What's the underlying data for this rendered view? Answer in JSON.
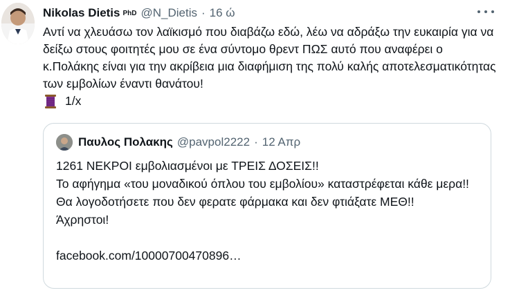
{
  "tweet": {
    "author_name": "Nikolas Dietis",
    "author_suffix": "PhD",
    "handle": "@N_Dietis",
    "separator": "·",
    "time": "16 ώ",
    "text": "Αντί να χλευάσω τον λαϊκισμό που διαβάζω εδώ, λέω να αδράξω την ευκαιρία για να δείξω στους φοιτητές μου σε ένα σύντομο θρεντ ΠΩΣ αυτό που αναφέρει ο κ.Πολάκης είναι για την ακρίβεια μια διαφήμιση της πολύ καλής αποτελεσματικότητας των εμβολίων έναντι θανάτου!",
    "thread_icon": "thread-spool-icon",
    "thread_marker": "1/x"
  },
  "quote": {
    "author_name": "Παυλος Πολακης",
    "handle": "@pavpol2222",
    "separator": "·",
    "time": "12 Απρ",
    "lines": [
      "1261 ΝΕΚΡΟΙ εμβολιασμένοι με ΤΡΕΙΣ ΔΟΣΕΙΣ!!",
      "Το αφήγημα «του μοναδικού όπλου του εμβολίου» καταστρέφεται κάθε μερα!!",
      "Θα λογοδοτήσετε που δεν φερατε φάρμακα και δεν φτιάξατε ΜΕΘ!!",
      "Άχρηστοι!"
    ],
    "link": "facebook.com/10000700470896…"
  },
  "colors": {
    "text": "#0f1419",
    "secondary": "#536471",
    "border": "#cfd9de",
    "spool": "#7b2d8e"
  }
}
